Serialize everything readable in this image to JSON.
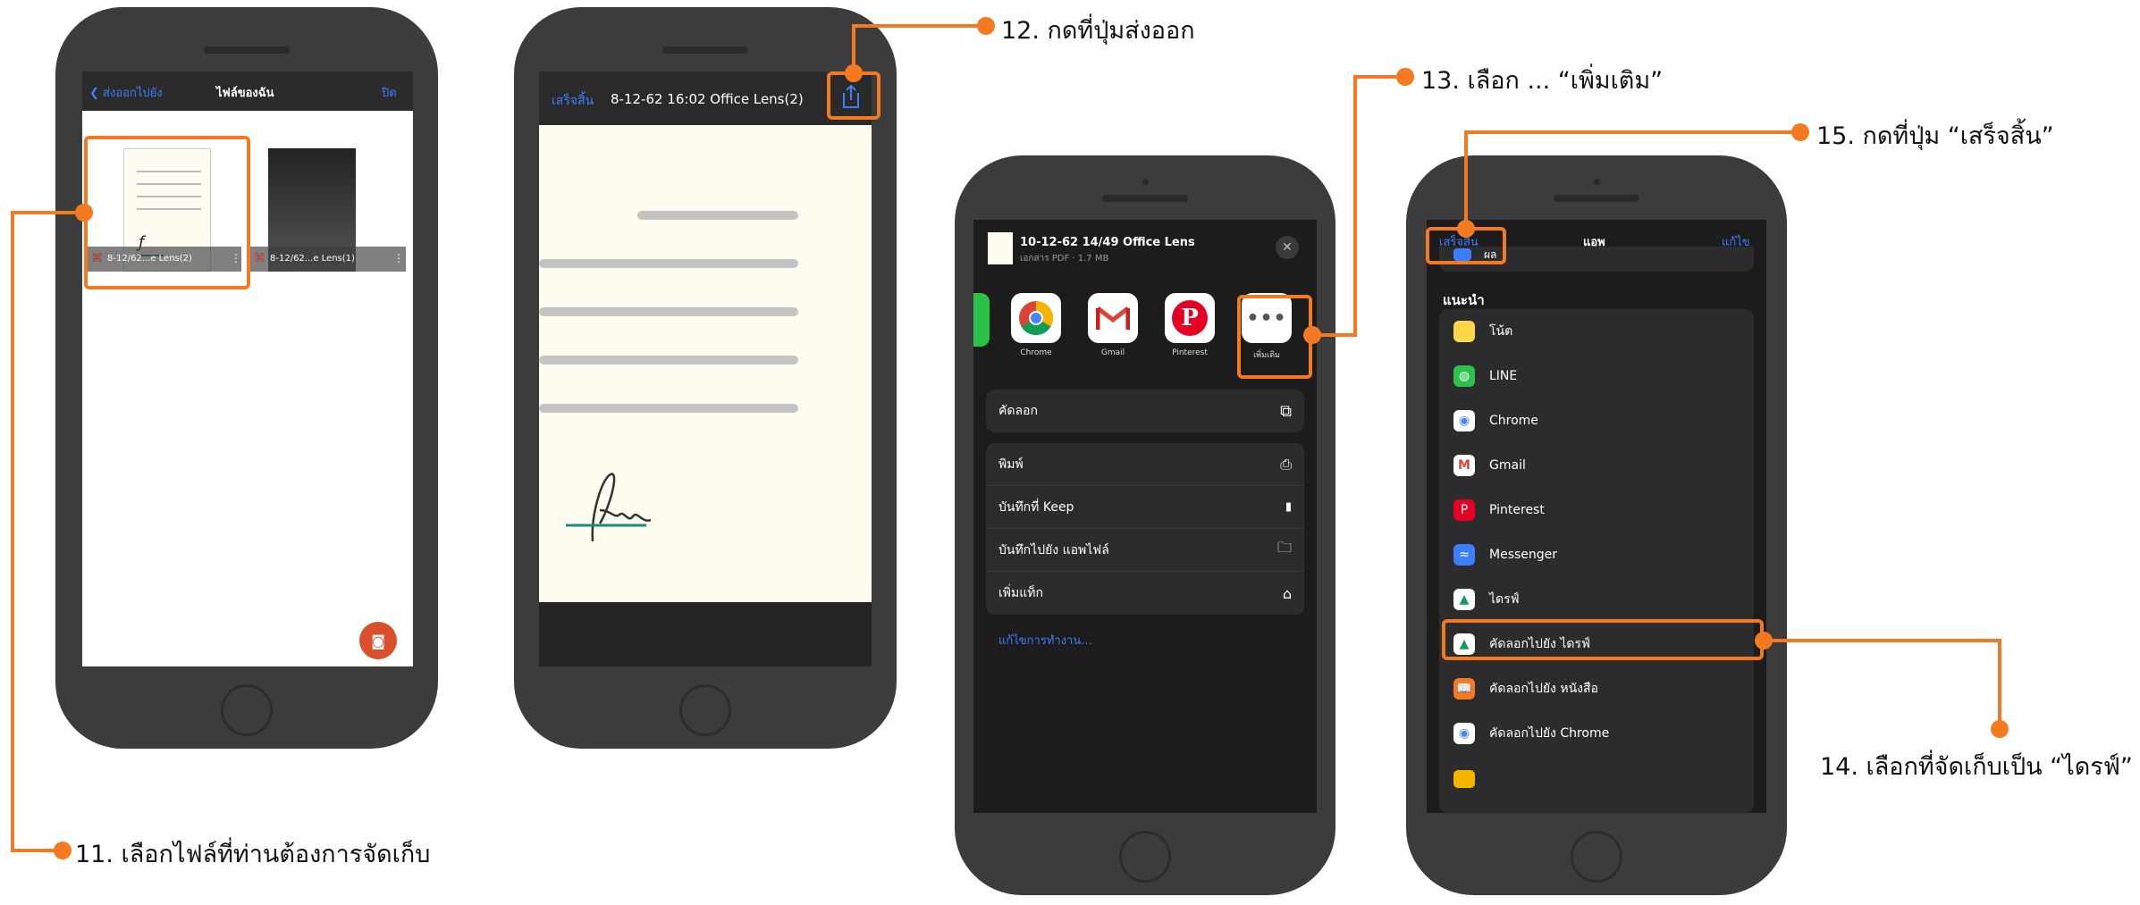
{
  "steps": {
    "s11": "11. เลือกไฟล์ที่ท่านต้องการจัดเก็บ",
    "s12": "12. กดที่ปุ่มส่งออก",
    "s13": "13. เลือก ... “เพิ่มเติม”",
    "s14": "14. เลือกที่จัดเก็บเป็น “ไดรฟ์”",
    "s15": "15. กดที่ปุ่ม “เสร็จสิ้น”"
  },
  "phone1": {
    "back_label": "ส่งออกไปยัง",
    "title": "ไฟล์ของฉัน",
    "close_label": "ปิด",
    "files": [
      {
        "name": "8-12/62...e Lens(2)"
      },
      {
        "name": "8-12/62...e Lens(1)"
      }
    ]
  },
  "phone2": {
    "done_label": "เสร็จสิ้น",
    "title": "8-12-62 16:02 Office Lens(2)"
  },
  "phone3": {
    "file_title": "10-12-62 14/49 Office Lens",
    "file_meta": "เอกสาร PDF · 1.7 MB",
    "apps": [
      "Chrome",
      "Gmail",
      "Pinterest",
      "เพิ่มเติม"
    ],
    "actions": {
      "copy": "คัดลอก",
      "print": "พิมพ์",
      "keep": "บันทึกที่ Keep",
      "save_files": "บันทึกไปยัง แอพไฟล์",
      "add_tag": "เพิ่มแท็ก",
      "edit_actions": "แก้ไขการทำงาน..."
    }
  },
  "phone4": {
    "done_label": "เสร็จสิ้น",
    "title": "แอพ",
    "edit_label": "แก้ไข",
    "partial_top": "ผล",
    "section": "แนะนำ",
    "items": [
      "โน้ต",
      "LINE",
      "Chrome",
      "Gmail",
      "Pinterest",
      "Messenger",
      "ไดรฟ์",
      "คัดลอกไปยัง ไดรฟ์",
      "คัดลอกไปยัง หนังสือ",
      "คัดลอกไปยัง Chrome"
    ]
  },
  "colors": {
    "accent": "#f47920",
    "ios_blue": "#3d7eff"
  }
}
